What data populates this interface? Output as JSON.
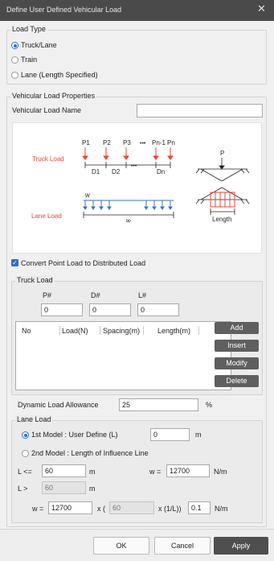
{
  "window": {
    "title": "Define User Defined Vehicular Load",
    "close_glyph": "✕"
  },
  "load_type": {
    "legend": "Load Type",
    "options": [
      "Truck/Lane",
      "Train",
      "Lane (Length Specified)"
    ],
    "selected": "Truck/Lane"
  },
  "properties": {
    "legend": "Vehicular Load Properties",
    "name_label": "Vehicular Load Name",
    "name_value": ""
  },
  "diagram": {
    "truck_label": "Truck Load",
    "lane_label": "Lane Load",
    "point_labels": [
      "P1",
      "P2",
      "P3",
      "Pn-1",
      "Pn"
    ],
    "dots": "•••",
    "spacing_labels": [
      "D1",
      "D2",
      "Dn"
    ],
    "lane_w": "w",
    "lane_inf": "∞",
    "side_p": "P",
    "side_length": "Length",
    "accent_color": "#ee4433",
    "load_color": "#3a72c8"
  },
  "convert": {
    "label": "Convert Point Load to Distributed Load",
    "checked": true
  },
  "truck_load": {
    "legend": "Truck Load",
    "p_label": "P#",
    "d_label": "D#",
    "l_label": "L#",
    "p_value": "0",
    "d_value": "0",
    "l_value": "0",
    "columns": [
      "No",
      "Load(N)",
      "Spacing(m)",
      "Length(m)"
    ],
    "rows": [],
    "buttons": {
      "add": "Add",
      "insert": "Insert",
      "modify": "Modify",
      "delete": "Delete"
    }
  },
  "dla": {
    "label": "Dynamic Load Allowance",
    "value": "25",
    "unit": "%"
  },
  "lane_load": {
    "legend": "Lane Load",
    "model1_label": "1st Model : User Define (L)",
    "model1_value": "0",
    "model1_unit": "m",
    "model2_label": "2nd Model : Length of  Influence Line",
    "selected": "1st Model : User Define (L)",
    "l_le_label": "L <=",
    "l_le_value": "60",
    "l_le_unit": "m",
    "w1_label": "w =",
    "w1_value": "12700",
    "w1_unit": "N/m",
    "l_gt_label": "L >",
    "l_gt_value": "60",
    "l_gt_unit": "m",
    "w2_label": "w =",
    "w2_value": "12700",
    "w2_mid": "x (",
    "w2_disabled_value": "60",
    "w2_suffix": "x (1/L))",
    "w2_factor": "0.1",
    "w2_unit": "N/m"
  },
  "footer": {
    "ok": "OK",
    "cancel": "Cancel",
    "apply": "Apply"
  }
}
